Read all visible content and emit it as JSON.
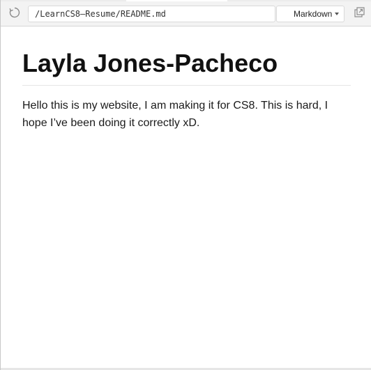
{
  "toolbar": {
    "file_path": "/LearnCS8—Resume/README.md",
    "mode_label": "Markdown"
  },
  "document": {
    "heading": "Layla Jones-Pacheco",
    "paragraph": "Hello this is my website, I am making it for CS8. This is hard, I hope I’ve been doing it correctly xD."
  },
  "icons": {
    "reload": "reload-icon",
    "popout": "popout-window-icon",
    "caret": "chevron-down-icon"
  },
  "colors": {
    "toolbar_bg": "#f3f3f3",
    "heading": "#111111",
    "text": "#1a1a1a"
  }
}
